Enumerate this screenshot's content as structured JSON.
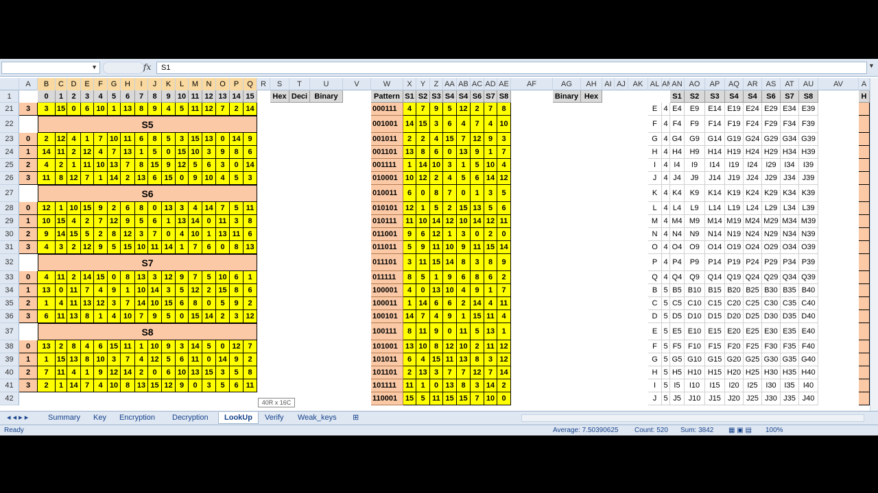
{
  "formula_bar": {
    "name_box": "",
    "cell_content": "S1",
    "fx": "fx"
  },
  "columns": [
    "A",
    "B",
    "C",
    "D",
    "E",
    "F",
    "G",
    "H",
    "I",
    "J",
    "K",
    "L",
    "M",
    "N",
    "O",
    "P",
    "Q",
    "R",
    "S",
    "T",
    "U",
    "V",
    "W",
    "X",
    "Y",
    "Z",
    "AA",
    "AB",
    "AC",
    "AD",
    "AE",
    "AF",
    "AG",
    "AH",
    "AI",
    "AJ",
    "AK",
    "AL",
    "AM",
    "AN",
    "AO",
    "AP",
    "AQ",
    "AR",
    "AS",
    "AT",
    "AU",
    "AV",
    "A"
  ],
  "row_numbers": [
    "1",
    "21",
    "22",
    "23",
    "24",
    "25",
    "26",
    "27",
    "28",
    "29",
    "30",
    "31",
    "32",
    "33",
    "34",
    "35",
    "36",
    "37",
    "38",
    "39",
    "40",
    "41",
    "42"
  ],
  "left_header": [
    "0",
    "1",
    "2",
    "3",
    "4",
    "5",
    "6",
    "7",
    "8",
    "9",
    "10",
    "11",
    "12",
    "13",
    "14",
    "15"
  ],
  "sbox_titles": {
    "22": "S5",
    "27": "S6",
    "32": "S7",
    "37": "S8"
  },
  "left_rows": {
    "21": [
      "3",
      "3",
      "15",
      "0",
      "6",
      "10",
      "1",
      "13",
      "8",
      "9",
      "4",
      "5",
      "11",
      "12",
      "7",
      "2",
      "14"
    ],
    "23": [
      "0",
      "2",
      "12",
      "4",
      "1",
      "7",
      "10",
      "11",
      "6",
      "8",
      "5",
      "3",
      "15",
      "13",
      "0",
      "14",
      "9"
    ],
    "24": [
      "1",
      "14",
      "11",
      "2",
      "12",
      "4",
      "7",
      "13",
      "1",
      "5",
      "0",
      "15",
      "10",
      "3",
      "9",
      "8",
      "6"
    ],
    "25": [
      "2",
      "4",
      "2",
      "1",
      "11",
      "10",
      "13",
      "7",
      "8",
      "15",
      "9",
      "12",
      "5",
      "6",
      "3",
      "0",
      "14"
    ],
    "26": [
      "3",
      "11",
      "8",
      "12",
      "7",
      "1",
      "14",
      "2",
      "13",
      "6",
      "15",
      "0",
      "9",
      "10",
      "4",
      "5",
      "3"
    ],
    "28": [
      "0",
      "12",
      "1",
      "10",
      "15",
      "9",
      "2",
      "6",
      "8",
      "0",
      "13",
      "3",
      "4",
      "14",
      "7",
      "5",
      "11"
    ],
    "29": [
      "1",
      "10",
      "15",
      "4",
      "2",
      "7",
      "12",
      "9",
      "5",
      "6",
      "1",
      "13",
      "14",
      "0",
      "11",
      "3",
      "8"
    ],
    "30": [
      "2",
      "9",
      "14",
      "15",
      "5",
      "2",
      "8",
      "12",
      "3",
      "7",
      "0",
      "4",
      "10",
      "1",
      "13",
      "11",
      "6"
    ],
    "31": [
      "3",
      "4",
      "3",
      "2",
      "12",
      "9",
      "5",
      "15",
      "10",
      "11",
      "14",
      "1",
      "7",
      "6",
      "0",
      "8",
      "13"
    ],
    "33": [
      "0",
      "4",
      "11",
      "2",
      "14",
      "15",
      "0",
      "8",
      "13",
      "3",
      "12",
      "9",
      "7",
      "5",
      "10",
      "6",
      "1"
    ],
    "34": [
      "1",
      "13",
      "0",
      "11",
      "7",
      "4",
      "9",
      "1",
      "10",
      "14",
      "3",
      "5",
      "12",
      "2",
      "15",
      "8",
      "6"
    ],
    "35": [
      "2",
      "1",
      "4",
      "11",
      "13",
      "12",
      "3",
      "7",
      "14",
      "10",
      "15",
      "6",
      "8",
      "0",
      "5",
      "9",
      "2"
    ],
    "36": [
      "3",
      "6",
      "11",
      "13",
      "8",
      "1",
      "4",
      "10",
      "7",
      "9",
      "5",
      "0",
      "15",
      "14",
      "2",
      "3",
      "12"
    ],
    "38": [
      "0",
      "13",
      "2",
      "8",
      "4",
      "6",
      "15",
      "11",
      "1",
      "10",
      "9",
      "3",
      "14",
      "5",
      "0",
      "12",
      "7"
    ],
    "39": [
      "1",
      "1",
      "15",
      "13",
      "8",
      "10",
      "3",
      "7",
      "4",
      "12",
      "5",
      "6",
      "11",
      "0",
      "14",
      "9",
      "2"
    ],
    "40": [
      "2",
      "7",
      "11",
      "4",
      "1",
      "9",
      "12",
      "14",
      "2",
      "0",
      "6",
      "10",
      "13",
      "15",
      "3",
      "5",
      "8"
    ],
    "41": [
      "3",
      "2",
      "1",
      "14",
      "7",
      "4",
      "10",
      "8",
      "13",
      "15",
      "12",
      "9",
      "0",
      "3",
      "5",
      "6",
      "11"
    ]
  },
  "mid_header": [
    "Hex",
    "Deci",
    "Binary"
  ],
  "pattern_header": [
    "Pattern",
    "S1",
    "S2",
    "S3",
    "S4",
    "S4",
    "S6",
    "S7",
    "S8"
  ],
  "pattern_rows": {
    "21": [
      "000111",
      "4",
      "7",
      "9",
      "5",
      "12",
      "2",
      "7",
      "8"
    ],
    "22": [
      "001001",
      "14",
      "15",
      "3",
      "6",
      "4",
      "7",
      "4",
      "10"
    ],
    "23": [
      "001011",
      "2",
      "2",
      "4",
      "15",
      "7",
      "12",
      "9",
      "3"
    ],
    "24": [
      "001101",
      "13",
      "8",
      "6",
      "0",
      "13",
      "9",
      "1",
      "7"
    ],
    "25": [
      "001111",
      "1",
      "14",
      "10",
      "3",
      "1",
      "5",
      "10",
      "4"
    ],
    "26": [
      "010001",
      "10",
      "12",
      "2",
      "4",
      "5",
      "6",
      "14",
      "12"
    ],
    "27": [
      "010011",
      "6",
      "0",
      "8",
      "7",
      "0",
      "1",
      "3",
      "5"
    ],
    "28": [
      "010101",
      "12",
      "1",
      "5",
      "2",
      "15",
      "13",
      "5",
      "6"
    ],
    "29": [
      "010111",
      "11",
      "10",
      "14",
      "12",
      "10",
      "14",
      "12",
      "11"
    ],
    "30": [
      "011001",
      "9",
      "6",
      "12",
      "1",
      "3",
      "0",
      "2",
      "0"
    ],
    "31": [
      "011011",
      "5",
      "9",
      "11",
      "10",
      "9",
      "11",
      "15",
      "14"
    ],
    "32": [
      "011101",
      "3",
      "11",
      "15",
      "14",
      "8",
      "3",
      "8",
      "9"
    ],
    "33": [
      "011111",
      "8",
      "5",
      "1",
      "9",
      "6",
      "8",
      "6",
      "2"
    ],
    "34": [
      "100001",
      "4",
      "0",
      "13",
      "10",
      "4",
      "9",
      "1",
      "7"
    ],
    "35": [
      "100011",
      "1",
      "14",
      "6",
      "6",
      "2",
      "14",
      "4",
      "11"
    ],
    "36": [
      "100101",
      "14",
      "7",
      "4",
      "9",
      "1",
      "15",
      "11",
      "4"
    ],
    "37": [
      "100111",
      "8",
      "11",
      "9",
      "0",
      "11",
      "5",
      "13",
      "1"
    ],
    "38": [
      "101001",
      "13",
      "10",
      "8",
      "12",
      "10",
      "2",
      "11",
      "12"
    ],
    "39": [
      "101011",
      "6",
      "4",
      "15",
      "11",
      "13",
      "8",
      "3",
      "12"
    ],
    "40": [
      "101101",
      "2",
      "13",
      "3",
      "7",
      "7",
      "12",
      "7",
      "14"
    ],
    "41": [
      "101111",
      "11",
      "1",
      "0",
      "13",
      "8",
      "3",
      "14",
      "2"
    ],
    "42": [
      "110001",
      "15",
      "5",
      "11",
      "15",
      "15",
      "7",
      "10",
      "0"
    ]
  },
  "ag_header": [
    "Binary",
    "Hex"
  ],
  "right_header": [
    "S1",
    "S2",
    "S3",
    "S4",
    "S4",
    "S6",
    "S7",
    "S8"
  ],
  "right_rows": {
    "21": [
      "E",
      "4",
      "E4",
      "E9",
      "E14",
      "E19",
      "E24",
      "E29",
      "E34",
      "E39"
    ],
    "22": [
      "F",
      "4",
      "F4",
      "F9",
      "F14",
      "F19",
      "F24",
      "F29",
      "F34",
      "F39"
    ],
    "23": [
      "G",
      "4",
      "G4",
      "G9",
      "G14",
      "G19",
      "G24",
      "G29",
      "G34",
      "G39"
    ],
    "24": [
      "H",
      "4",
      "H4",
      "H9",
      "H14",
      "H19",
      "H24",
      "H29",
      "H34",
      "H39"
    ],
    "25": [
      "I",
      "4",
      "I4",
      "I9",
      "I14",
      "I19",
      "I24",
      "I29",
      "I34",
      "I39"
    ],
    "26": [
      "J",
      "4",
      "J4",
      "J9",
      "J14",
      "J19",
      "J24",
      "J29",
      "J34",
      "J39"
    ],
    "27": [
      "K",
      "4",
      "K4",
      "K9",
      "K14",
      "K19",
      "K24",
      "K29",
      "K34",
      "K39"
    ],
    "28": [
      "L",
      "4",
      "L4",
      "L9",
      "L14",
      "L19",
      "L24",
      "L29",
      "L34",
      "L39"
    ],
    "29": [
      "M",
      "4",
      "M4",
      "M9",
      "M14",
      "M19",
      "M24",
      "M29",
      "M34",
      "M39"
    ],
    "30": [
      "N",
      "4",
      "N4",
      "N9",
      "N14",
      "N19",
      "N24",
      "N29",
      "N34",
      "N39"
    ],
    "31": [
      "O",
      "4",
      "O4",
      "O9",
      "O14",
      "O19",
      "O24",
      "O29",
      "O34",
      "O39"
    ],
    "32": [
      "P",
      "4",
      "P4",
      "P9",
      "P14",
      "P19",
      "P24",
      "P29",
      "P34",
      "P39"
    ],
    "33": [
      "Q",
      "4",
      "Q4",
      "Q9",
      "Q14",
      "Q19",
      "Q24",
      "Q29",
      "Q34",
      "Q39"
    ],
    "34": [
      "B",
      "5",
      "B5",
      "B10",
      "B15",
      "B20",
      "B25",
      "B30",
      "B35",
      "B40"
    ],
    "35": [
      "C",
      "5",
      "C5",
      "C10",
      "C15",
      "C20",
      "C25",
      "C30",
      "C35",
      "C40"
    ],
    "36": [
      "D",
      "5",
      "D5",
      "D10",
      "D15",
      "D20",
      "D25",
      "D30",
      "D35",
      "D40"
    ],
    "37": [
      "E",
      "5",
      "E5",
      "E10",
      "E15",
      "E20",
      "E25",
      "E30",
      "E35",
      "E40"
    ],
    "38": [
      "F",
      "5",
      "F5",
      "F10",
      "F15",
      "F20",
      "F25",
      "F30",
      "F35",
      "F40"
    ],
    "39": [
      "G",
      "5",
      "G5",
      "G10",
      "G15",
      "G20",
      "G25",
      "G30",
      "G35",
      "G40"
    ],
    "40": [
      "H",
      "5",
      "H5",
      "H10",
      "H15",
      "H20",
      "H25",
      "H30",
      "H35",
      "H40"
    ],
    "41": [
      "I",
      "5",
      "I5",
      "I10",
      "I15",
      "I20",
      "I25",
      "I30",
      "I35",
      "I40"
    ],
    "42": [
      "J",
      "5",
      "J5",
      "J10",
      "J15",
      "J20",
      "J25",
      "J30",
      "J35",
      "J40"
    ]
  },
  "far_right_header": "H",
  "tooltip": "40R x 16C",
  "tabs": [
    "Summary",
    "Key",
    "Encryption",
    "Decryption",
    "LookUp",
    "Verify",
    "Weak_keys"
  ],
  "active_tab": "LookUp",
  "status": {
    "mode": "Ready",
    "average": "Average: 7.50390625",
    "count": "Count: 520",
    "sum": "Sum: 3842",
    "zoom": "100%"
  }
}
